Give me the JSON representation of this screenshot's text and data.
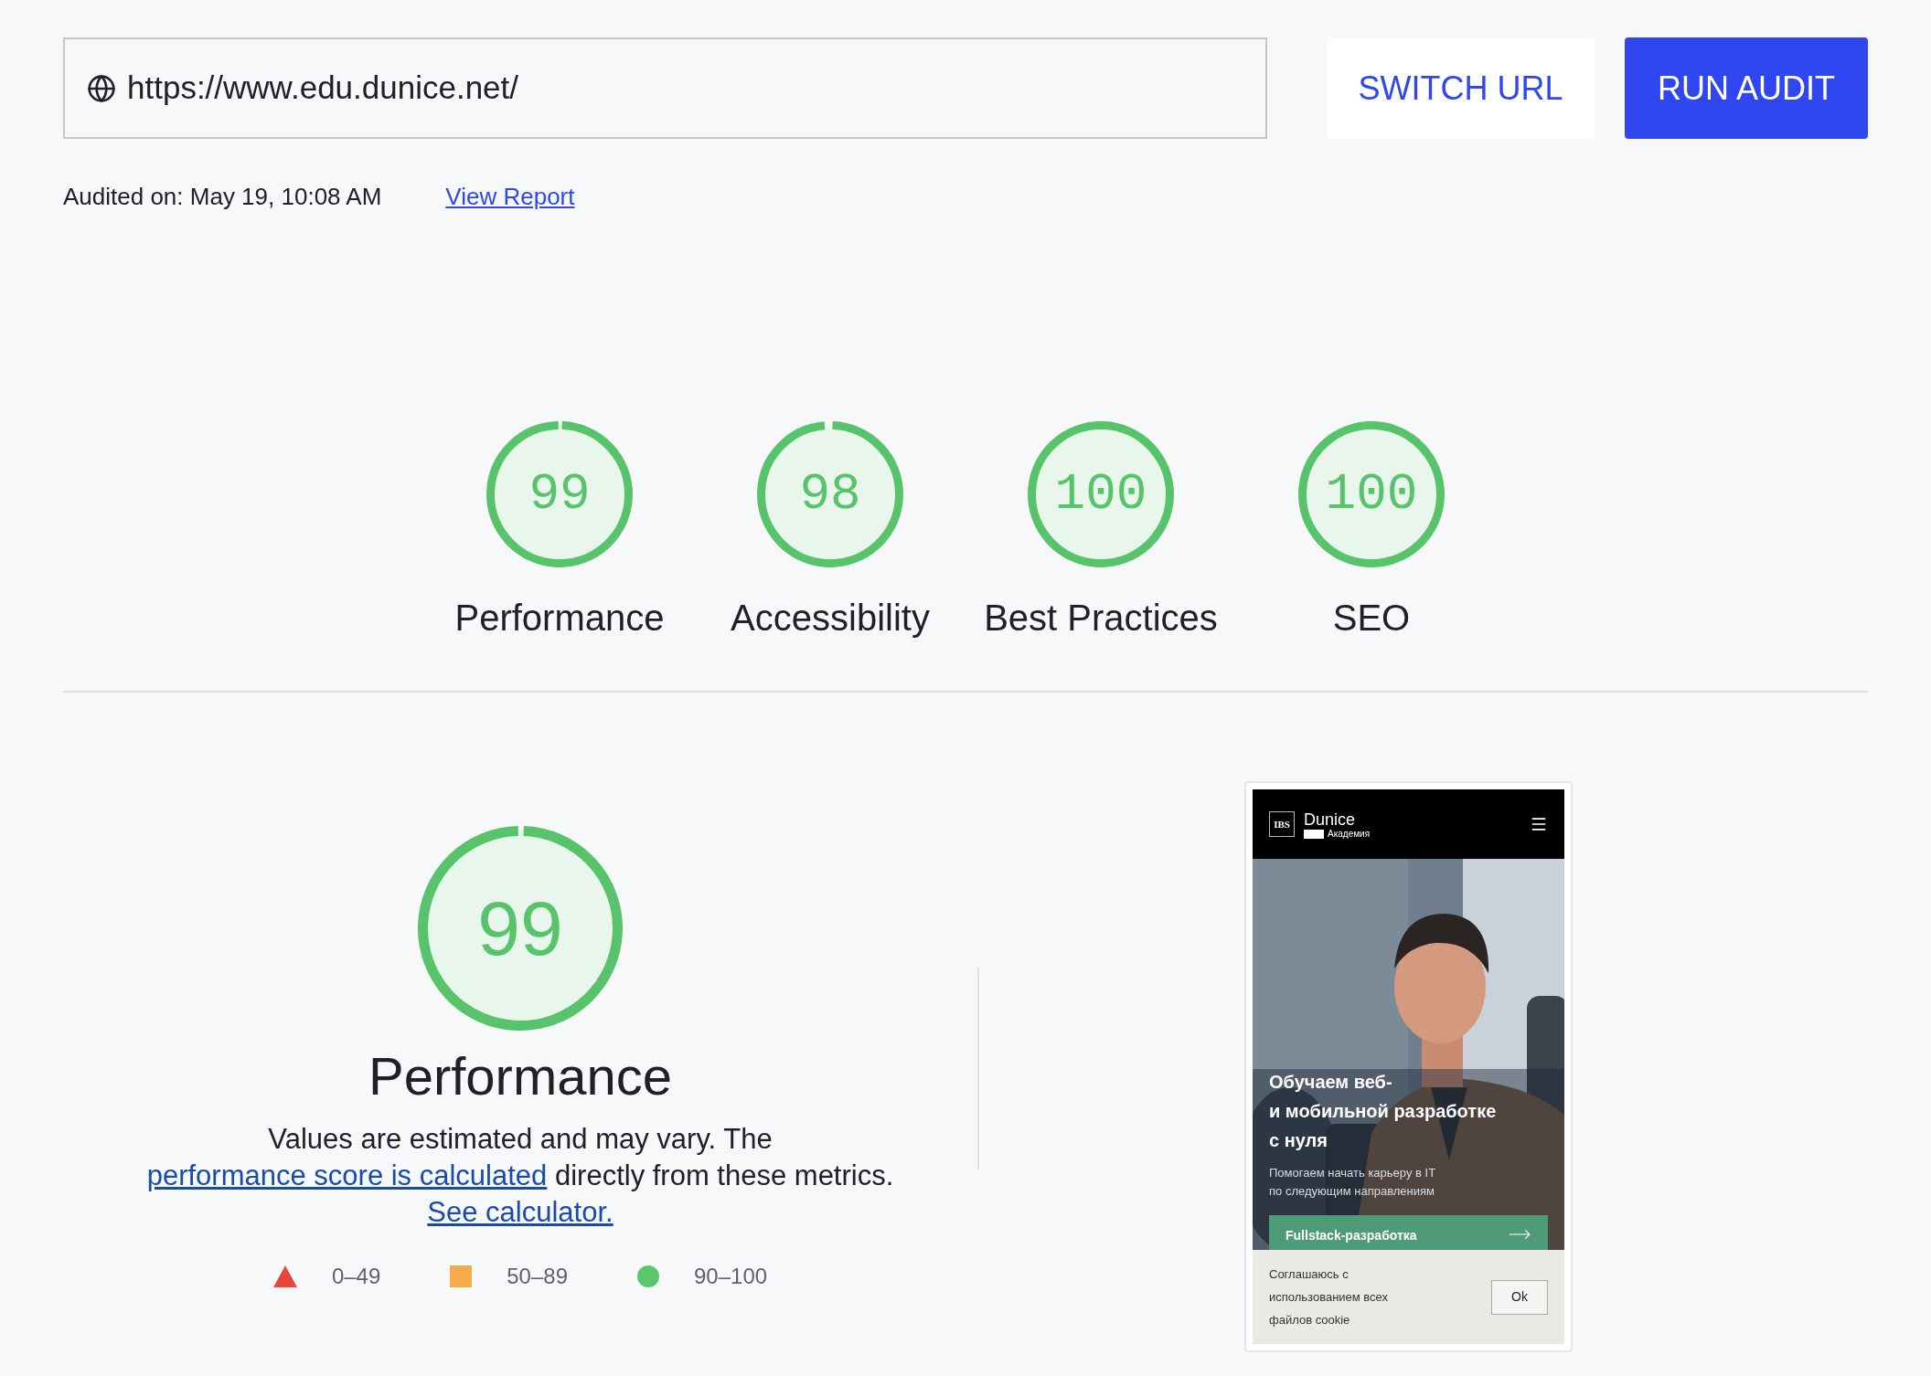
{
  "url_field": {
    "value": "https://www.edu.dunice.net/"
  },
  "buttons": [
    {
      "label": "SWITCH URL",
      "kind": "secondary"
    },
    {
      "label": "RUN AUDIT",
      "kind": "primary"
    }
  ],
  "audit_info": {
    "audited_on": "Audited on: May 19, 10:08 AM",
    "link": "View Report"
  },
  "gauges": [
    {
      "score": "99",
      "label": "Performance",
      "level": 0.99,
      "color": "#57c46b"
    },
    {
      "score": "98",
      "label": "Accessibility",
      "level": 0.98,
      "color": "#57c46b"
    },
    {
      "score": "100",
      "label": "Best Practices",
      "level": 1,
      "color": "#57c46b"
    },
    {
      "score": "100",
      "label": "SEO",
      "level": 1,
      "color": "#57c46b"
    }
  ],
  "performance": {
    "score": "99",
    "level": 0.99,
    "color": "#57c46b",
    "title": "Performance",
    "description": [
      {
        "text": "Values are estimated and may vary. The ",
        "link": false
      },
      {
        "text": "performance score is calculated",
        "link": true
      },
      {
        "text": " directly from these metrics. ",
        "link": false
      },
      {
        "text": "See calculator.",
        "link": true
      }
    ],
    "legend": [
      {
        "kind": "triangle",
        "label": "0–49",
        "color": "#e8453c"
      },
      {
        "kind": "square",
        "label": "50–89",
        "color": "#f4ab4b"
      },
      {
        "kind": "circle",
        "label": "90–100",
        "color": "#5ac76e"
      }
    ]
  },
  "preview": {
    "logo_mark": "IBS",
    "brand": "Dunice",
    "brand_sub": "Академия",
    "headline": [
      "Обучаем веб-",
      "и мобильной разработке",
      "с нуля"
    ],
    "subtitle": [
      "Помогаем начать карьеру в IT",
      "по следующим направлениям"
    ],
    "cta": "Fullstack-разработка",
    "cookie_text": "Соглашаюсь с использованием всех файлов cookie",
    "cookie_button": "Ok"
  }
}
